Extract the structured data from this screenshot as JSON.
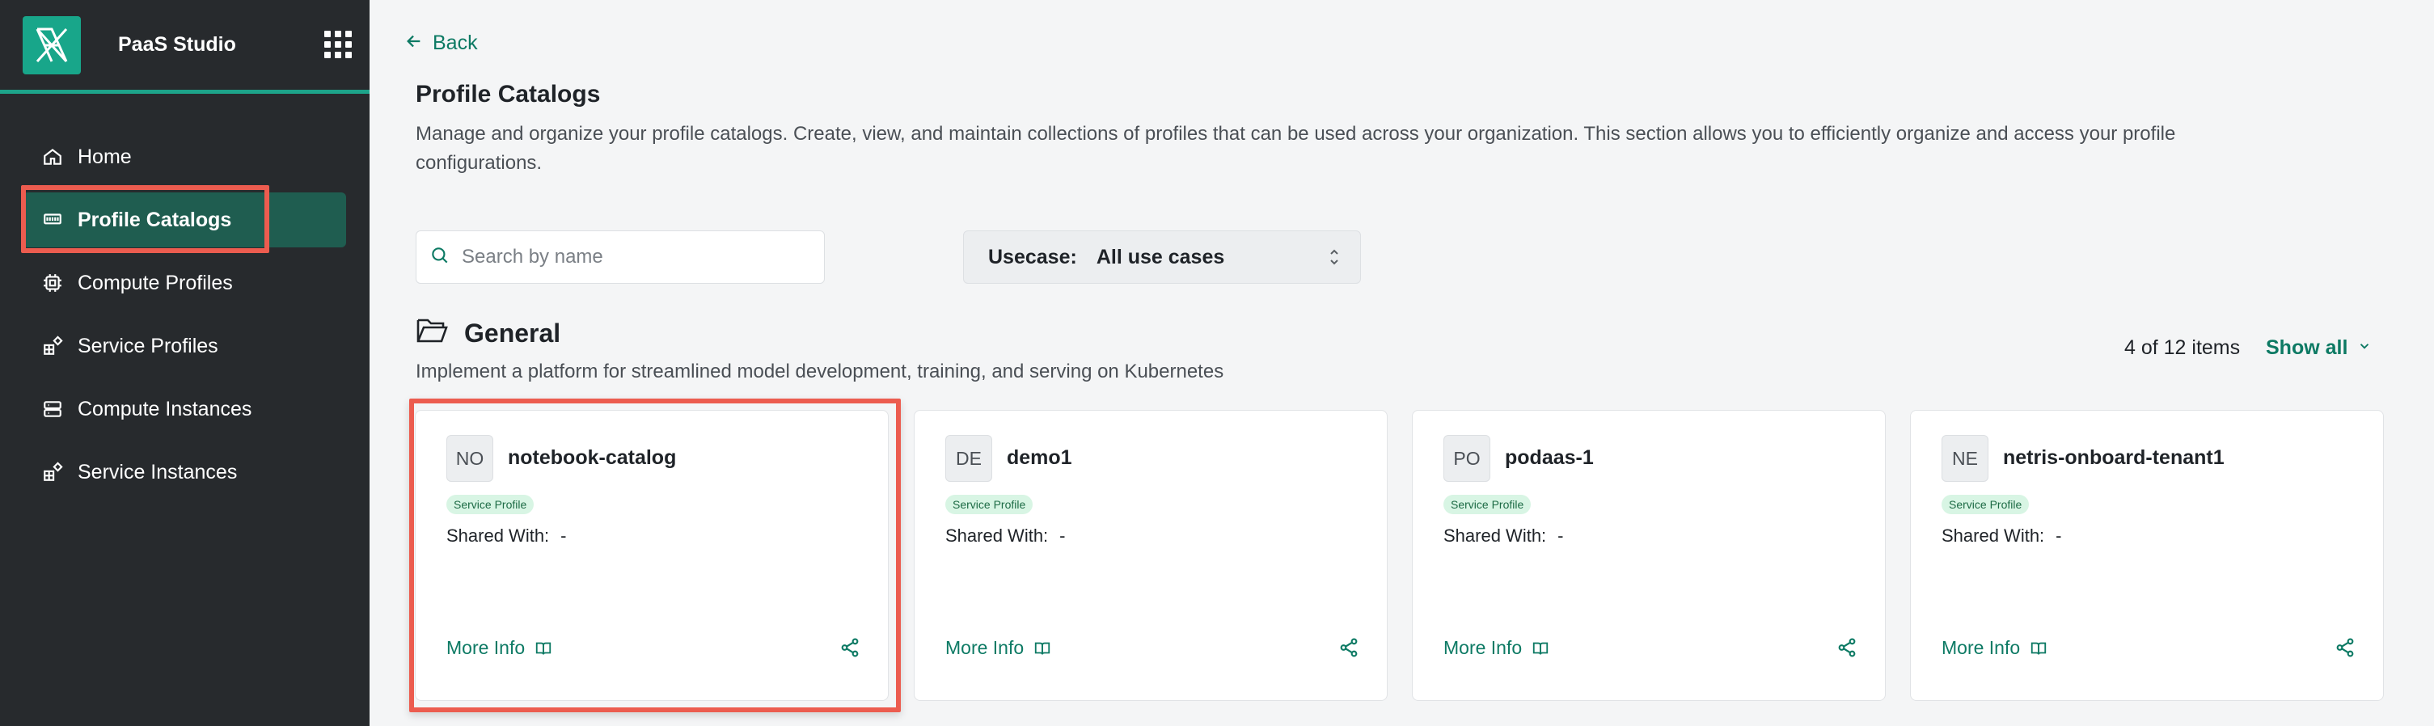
{
  "app": {
    "title": "PaaS Studio"
  },
  "sidebar": {
    "items": [
      {
        "label": "Home",
        "icon": "home-icon"
      },
      {
        "label": "Profile Catalogs",
        "icon": "catalog-icon",
        "active": true
      },
      {
        "label": "Compute Profiles",
        "icon": "chip-icon"
      },
      {
        "label": "Service Profiles",
        "icon": "blocks-icon"
      },
      {
        "label": "Compute Instances",
        "icon": "server-icon"
      },
      {
        "label": "Service Instances",
        "icon": "blocks-icon"
      }
    ]
  },
  "main": {
    "back_label": "Back",
    "title": "Profile Catalogs",
    "description": "Manage and organize your profile catalogs. Create, view, and maintain collections of profiles that can be used across your organization. This section allows you to efficiently organize and access your profile configurations.",
    "search": {
      "placeholder": "Search by name",
      "value": ""
    },
    "usecase": {
      "label": "Usecase:",
      "value": "All use cases"
    },
    "group": {
      "title": "General",
      "description": "Implement a platform for streamlined model development, training, and serving on Kubernetes",
      "count": "4 of 12 items",
      "show_all": "Show all"
    },
    "cards": [
      {
        "initials": "NO",
        "name": "notebook-catalog",
        "badge": "Service Profile",
        "shared_label": "Shared With:",
        "shared_value": "-",
        "more": "More Info"
      },
      {
        "initials": "DE",
        "name": "demo1",
        "badge": "Service Profile",
        "shared_label": "Shared With:",
        "shared_value": "-",
        "more": "More Info"
      },
      {
        "initials": "PO",
        "name": "podaas-1",
        "badge": "Service Profile",
        "shared_label": "Shared With:",
        "shared_value": "-",
        "more": "More Info"
      },
      {
        "initials": "NE",
        "name": "netris-onboard-tenant1",
        "badge": "Service Profile",
        "shared_label": "Shared With:",
        "shared_value": "-",
        "more": "More Info"
      }
    ]
  },
  "colors": {
    "accent": "#1da48a",
    "link": "#0d7a64",
    "highlight": "#ec5c4f",
    "sidebar_bg": "#272a2d"
  }
}
